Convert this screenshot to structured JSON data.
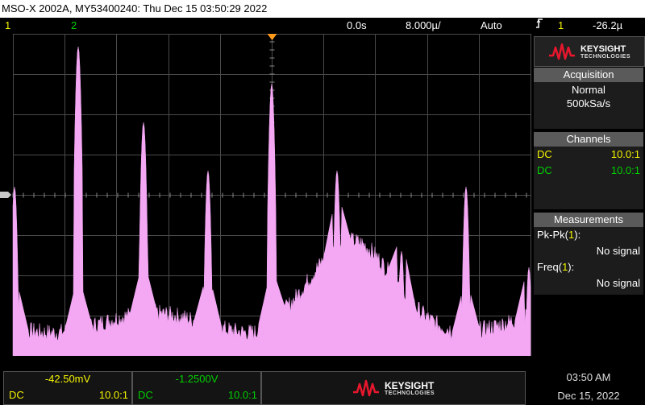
{
  "title": "MSO-X 2002A, MY53400240: Thu Dec 15 03:50:29 2022",
  "status": {
    "ch1": "1",
    "ch2": "2",
    "delay": "0.0s",
    "timebase": "8.000µ/",
    "mode": "Auto",
    "trigger_icon": "trigger-edge-icon",
    "trigger_source": "1",
    "trigger_level": "-26.2µ"
  },
  "brand": {
    "name": "KEYSIGHT",
    "sub": "TECHNOLOGIES",
    "color": "#e8172d"
  },
  "acquisition": {
    "title": "Acquisition",
    "mode": "Normal",
    "rate": "500kSa/s"
  },
  "channels": {
    "title": "Channels",
    "ch1_coupling": "DC",
    "ch1_probe": "10.0:1",
    "ch2_coupling": "DC",
    "ch2_probe": "10.0:1"
  },
  "measurements": {
    "title": "Measurements",
    "pkpk_label": "Pk-Pk(",
    "pkpk_ch": "1",
    "pkpk_end": "):",
    "pkpk_value": "No signal",
    "freq_label": "Freq(",
    "freq_ch": "1",
    "freq_end": "):",
    "freq_value": "No signal"
  },
  "bottom": {
    "ch1_offset": "-42.50mV",
    "ch1_coupling": "DC",
    "ch1_probe": "10.0:1",
    "ch2_offset": "-1.2500V",
    "ch2_coupling": "DC",
    "ch2_probe": "10.0:1",
    "time": "03:50 AM",
    "date": "Dec 15, 2022"
  },
  "colors": {
    "trace": "#f4a8f4",
    "ch1": "#f4f400",
    "ch2": "#00d000",
    "grid": "#4a4a4a"
  }
}
